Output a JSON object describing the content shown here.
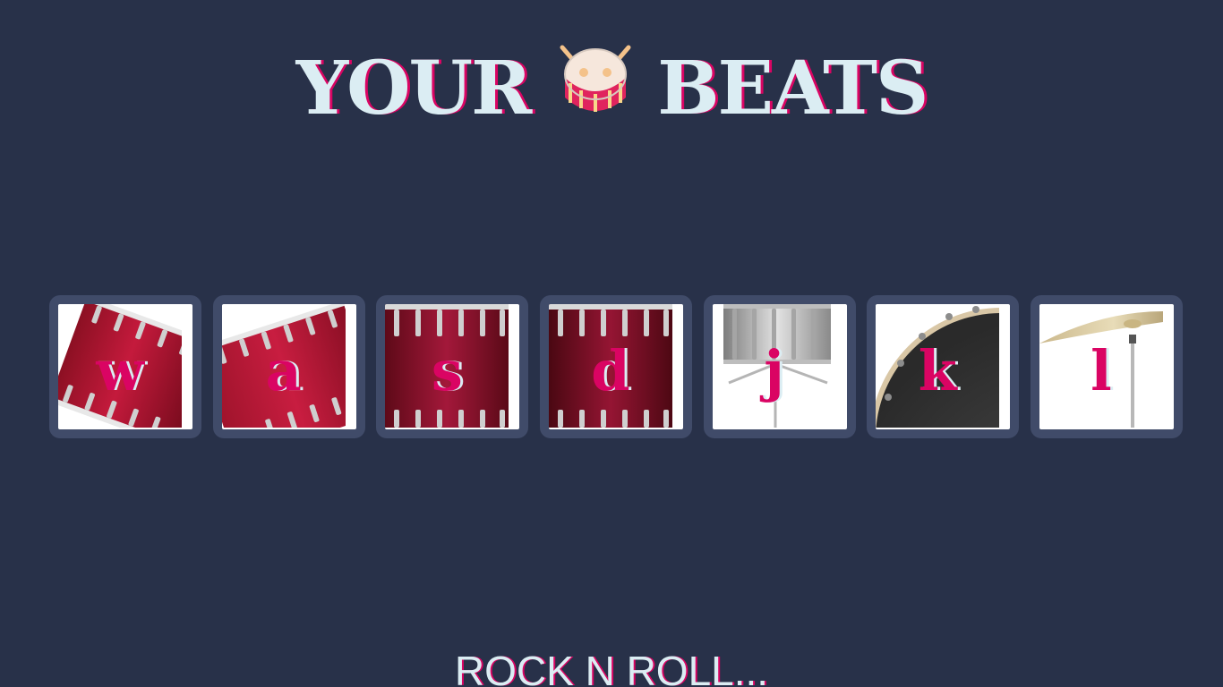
{
  "header": {
    "title_left": "YOUR",
    "title_right": "BEATS",
    "title_icon": "drum-icon"
  },
  "drums": [
    {
      "key": "w",
      "instrument": "tom-1-icon"
    },
    {
      "key": "a",
      "instrument": "tom-2-icon"
    },
    {
      "key": "s",
      "instrument": "tom-3-icon"
    },
    {
      "key": "d",
      "instrument": "tom-4-icon"
    },
    {
      "key": "j",
      "instrument": "snare-icon"
    },
    {
      "key": "k",
      "instrument": "kick-bass-icon"
    },
    {
      "key": "l",
      "instrument": "crash-cymbal-icon"
    }
  ],
  "footer": {
    "text": "ROCK N ROLL..."
  },
  "colors": {
    "background": "#283149",
    "tile_border": "#404b69",
    "accent": "#da0463",
    "text_light": "#dbedf3"
  }
}
